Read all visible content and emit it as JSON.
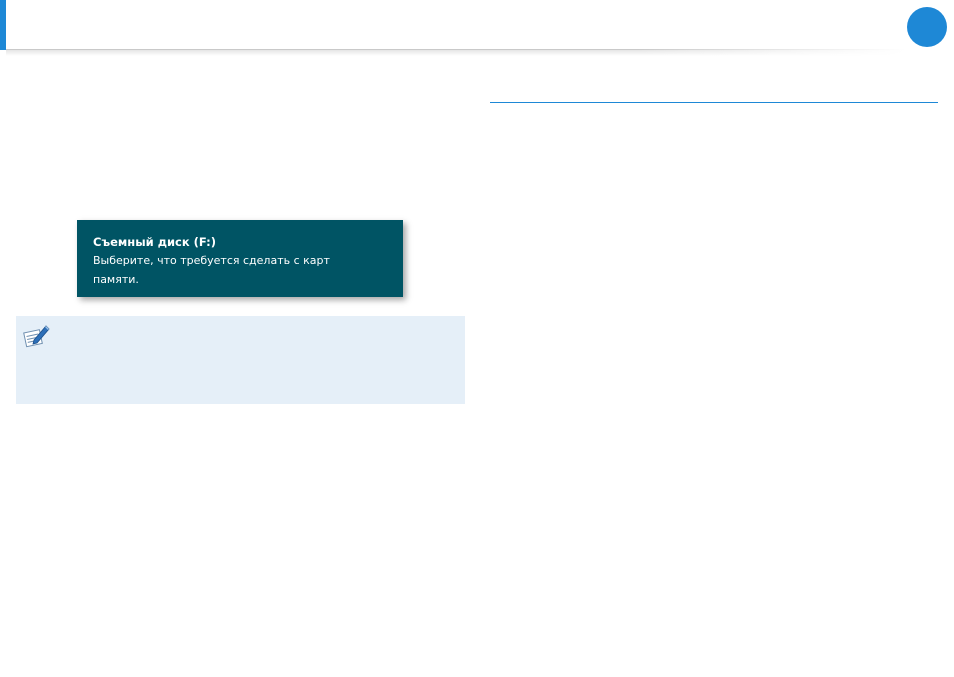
{
  "header": {
    "accent_color": "#1e88d6"
  },
  "section": {
    "rule_color": "#1e88d6"
  },
  "toast": {
    "title": "Съемный диск (F:)",
    "body": "Выберите, что требуется сделать с карт памяти.",
    "background": "#005464"
  },
  "note": {
    "icon": "note-pencil-icon",
    "background": "#e5eff8"
  }
}
